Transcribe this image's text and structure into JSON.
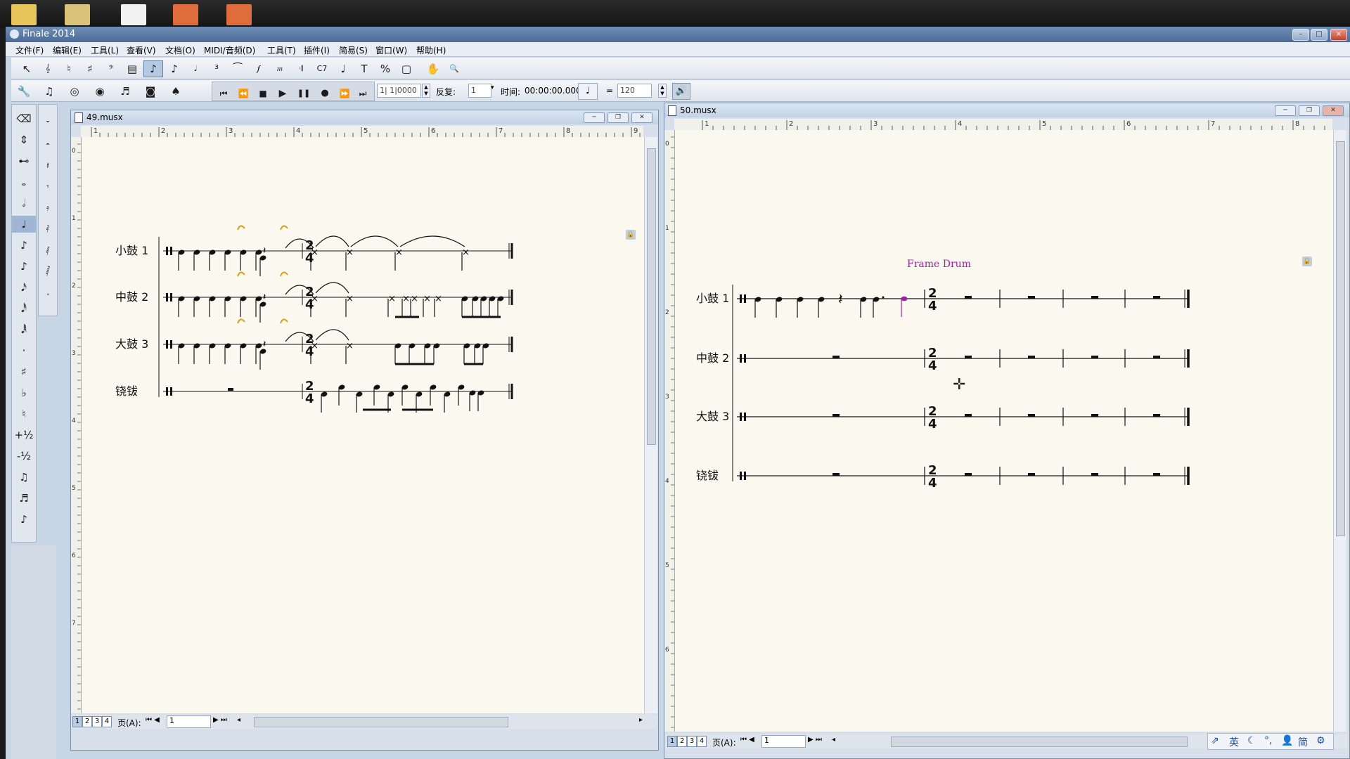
{
  "app": {
    "title": "Finale 2014",
    "window_controls": [
      "–",
      "□",
      "×"
    ]
  },
  "menubar": {
    "items": [
      "文件(F)",
      "编辑(E)",
      "工具(L)",
      "查看(V)",
      "文档(O)",
      "MIDI/音频(D)",
      "工具(T)",
      "插件(I)",
      "简易(S)",
      "窗口(W)",
      "帮助(H)"
    ]
  },
  "toolbar": {
    "tools": [
      "selection-tool-icon",
      "staff-tool-icon",
      "clef-tool-icon",
      "key-signature-tool-icon",
      "time-signature-tool-icon",
      "measure-tool-icon",
      "simple-entry-tool-icon",
      "speedy-entry-tool-icon",
      "hyperscribe-tool-icon",
      "tuplet-tool-icon",
      "smart-shape-tool-icon",
      "articulation-tool-icon",
      "expression-tool-icon",
      "repeat-tool-icon",
      "chord-tool-icon",
      "lyrics-tool-icon",
      "text-tool-icon",
      "resize-tool-icon",
      "page-layout-tool-icon",
      "hand-grabber-icon",
      "zoom-icon"
    ],
    "tool_glyphs": [
      "↖",
      "𝄞",
      "♮",
      "♯",
      "𝄢",
      "▤",
      "♪",
      "♪",
      "𝅘𝅥",
      "³",
      "⁀",
      "𝆑",
      "𝆐",
      "𝄇",
      "C7",
      "♩",
      "T",
      "%",
      "▢",
      "✋",
      "🔍"
    ],
    "tools2_glyphs": [
      "🔧",
      "♫",
      "◎",
      "◉",
      "♬",
      "◙",
      "♠"
    ]
  },
  "playback": {
    "buttons": [
      "⏮",
      "⏪",
      "■",
      "▶",
      "❚❚",
      "●",
      "⏩",
      "⏭"
    ],
    "measure_value": "1| 1|0000",
    "repeat_label": "反复:",
    "repeat_value": "1",
    "time_label": "时间:",
    "time_value": "00:00:00.000",
    "tempo_eq": "=",
    "tempo_value": "120"
  },
  "left_palette": {
    "glyphs": [
      "⌫",
      "⇕",
      "⊷",
      "𝅝",
      "𝅗𝅥",
      "♩",
      "♪",
      "♪",
      "𝅘𝅥𝅯",
      "𝅘𝅥𝅰",
      "𝅘𝅥𝅱",
      "·",
      "♯",
      "♭",
      "♮",
      "+½",
      "-½",
      "♫",
      "♬",
      "♪"
    ]
  },
  "left_palette2": {
    "glyphs": [
      "𝄻",
      "𝄼",
      "𝄽",
      "𝄾",
      "𝄿",
      "𝅀",
      "𝅁",
      "𝅂",
      "𝅃"
    ]
  },
  "doc1": {
    "title": "49.musx",
    "ruler_numbers": [
      "1",
      "2",
      "3",
      "4",
      "5",
      "6",
      "7",
      "8",
      "9"
    ],
    "vruler_numbers": [
      "0",
      "1",
      "2",
      "3",
      "4",
      "5",
      "6",
      "7"
    ],
    "instruments": [
      "小鼓 1",
      "中鼓 2",
      "大鼓 3",
      "铙钹"
    ],
    "time_signature_top": "2",
    "time_signature_bottom": "4",
    "pages": [
      "1",
      "2",
      "3",
      "4"
    ],
    "page_label": "页(A):",
    "page_value": "1"
  },
  "doc2": {
    "title": "50.musx",
    "ruler_numbers": [
      "1",
      "2",
      "3",
      "4",
      "5",
      "6",
      "7",
      "8"
    ],
    "vruler_numbers": [
      "0",
      "1",
      "2",
      "3",
      "4",
      "5",
      "6"
    ],
    "expression_text": "Frame Drum",
    "instruments": [
      "小鼓 1",
      "中鼓 2",
      "大鼓 3",
      "铙钹"
    ],
    "time_signature_top": "2",
    "time_signature_bottom": "4",
    "pages": [
      "1",
      "2",
      "3",
      "4"
    ],
    "page_label": "页(A):",
    "page_value": "1"
  },
  "ime": {
    "items": [
      "英",
      "简"
    ]
  },
  "colors": {
    "accent": "#4b6b95",
    "paper": "#fbf9ef",
    "fermata": "#d4a017",
    "expression": "#a020a0"
  }
}
